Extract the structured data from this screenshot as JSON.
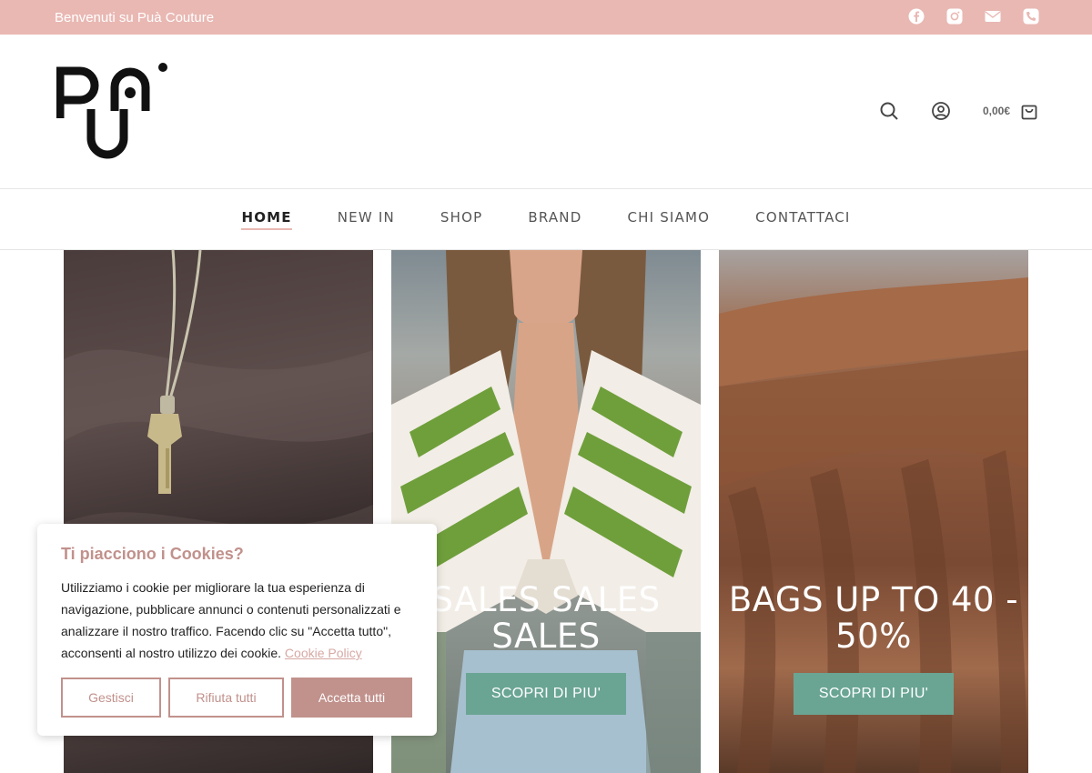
{
  "topbar": {
    "welcome": "Benvenuti su Puà Couture",
    "social_icons": [
      "facebook-icon",
      "instagram-icon",
      "mail-icon",
      "phone-icon"
    ],
    "bg_color": "#e9b8b3"
  },
  "header": {
    "logo_icon": "pua-logo",
    "cart_total": "0,00€"
  },
  "nav": {
    "items": [
      "HOME",
      "NEW IN",
      "SHOP",
      "BRAND",
      "CHI SIAMO",
      "CONTATTACI"
    ],
    "active": "HOME"
  },
  "panels": [
    {
      "title": "",
      "button": ""
    },
    {
      "title": "SALES SALES SALES",
      "button": "SCOPRI DI PIU'"
    },
    {
      "title": "BAGS UP TO 40 - 50%",
      "button": "SCOPRI DI PIU'"
    }
  ],
  "cookie": {
    "title": "Ti piacciono i Cookies?",
    "text": "Utilizziamo i cookie per migliorare la tua esperienza di navigazione, pubblicare annunci o contenuti personalizzati e analizzare il nostro traffico. Facendo clic su \"Accetta tutto\", acconsenti al nostro utilizzo dei cookie.",
    "link": "Cookie Policy",
    "manage": "Gestisci",
    "reject": "Rifiuta tutti",
    "accept": "Accetta tutti"
  },
  "colors": {
    "accent": "#c1918c",
    "button_green": "#6aa594"
  }
}
